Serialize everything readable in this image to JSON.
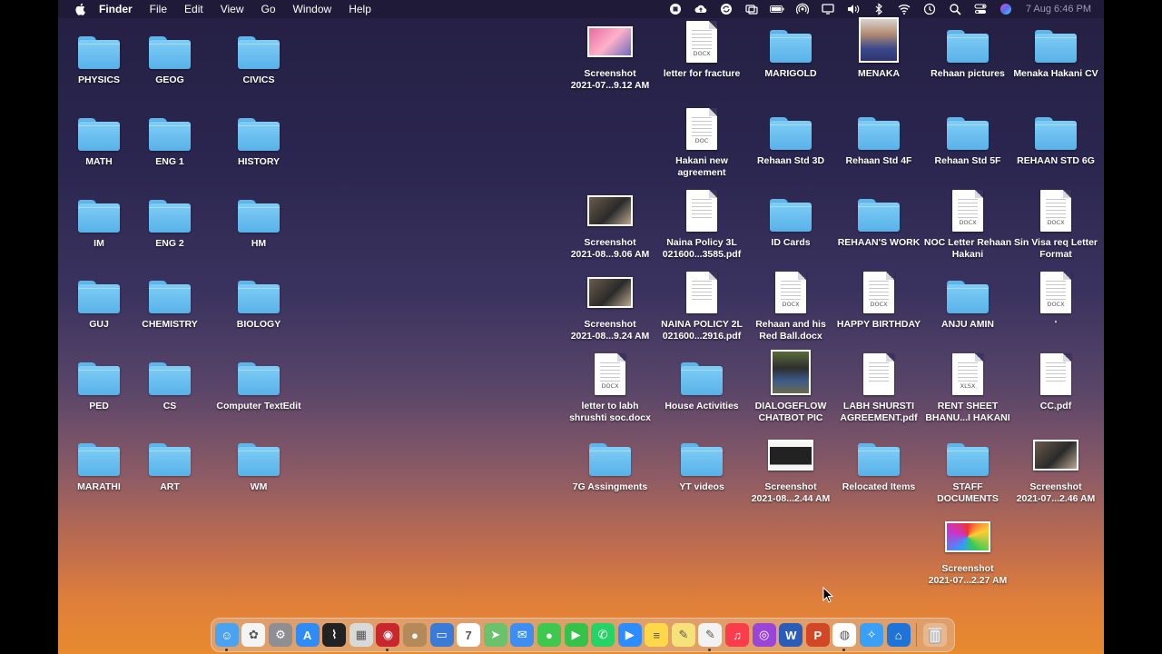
{
  "menubar": {
    "apple_icon": "apple-logo-icon",
    "app_name": "Finder",
    "menus": [
      "File",
      "Edit",
      "View",
      "Go",
      "Window",
      "Help"
    ],
    "status_icons": [
      "screen-record-icon",
      "creative-cloud-icon",
      "cloud-sync-icon",
      "display-mirror-icon",
      "battery-icon",
      "airdrop-icon",
      "screen-share-icon",
      "volume-icon",
      "bluetooth-icon",
      "wifi-icon",
      "time-machine-icon",
      "spotlight-icon",
      "control-center-icon",
      "siri-icon"
    ],
    "clock": "7 Aug  6:46 PM"
  },
  "desktop": {
    "left_grid": [
      {
        "label": "PHYSICS",
        "type": "folder"
      },
      {
        "label": "GEOG",
        "type": "folder"
      },
      {
        "label": "CIVICS",
        "type": "folder"
      },
      {
        "label": "MATH",
        "type": "folder"
      },
      {
        "label": "ENG 1",
        "type": "folder"
      },
      {
        "label": "HISTORY",
        "type": "folder"
      },
      {
        "label": "IM",
        "type": "folder"
      },
      {
        "label": "ENG 2",
        "type": "folder"
      },
      {
        "label": "HM",
        "type": "folder"
      },
      {
        "label": "GUJ",
        "type": "folder"
      },
      {
        "label": "CHEMISTRY",
        "type": "folder"
      },
      {
        "label": "BIOLOGY",
        "type": "folder"
      },
      {
        "label": "PED",
        "type": "folder"
      },
      {
        "label": "CS",
        "type": "folder"
      },
      {
        "label": "Computer TextEdit",
        "type": "folder"
      },
      {
        "label": "MARATHI",
        "type": "folder"
      },
      {
        "label": "ART",
        "type": "folder"
      },
      {
        "label": "WM",
        "type": "folder"
      }
    ],
    "right_grid": [
      {
        "label": "Screenshot\n2021-07...9.12 AM",
        "type": "shot",
        "variant": "pink"
      },
      {
        "label": "letter for fracture",
        "type": "doc",
        "ext": "DOCX"
      },
      {
        "label": "MARIGOLD",
        "type": "folder"
      },
      {
        "label": "MENAKA",
        "type": "photo",
        "variant": "menaka"
      },
      {
        "label": "Rehaan pictures",
        "type": "folder"
      },
      {
        "label": "Menaka Hakani CV",
        "type": "folder"
      },
      {
        "label": "Hakani new\nagreement",
        "type": "doc",
        "ext": "DOC"
      },
      {
        "label": "Rehaan Std 3D",
        "type": "folder"
      },
      {
        "label": "Rehaan Std 4F",
        "type": "folder"
      },
      {
        "label": "Rehaan Std 5F",
        "type": "folder"
      },
      {
        "label": "REHAAN STD 6G",
        "type": "folder"
      },
      {
        "label": "Screenshot\n2021-08...9.06 AM",
        "type": "shot",
        "variant": ""
      },
      {
        "label": "Naina Policy 3L\n021600...3585.pdf",
        "type": "doc",
        "ext": ""
      },
      {
        "label": "ID Cards",
        "type": "folder"
      },
      {
        "label": "REHAAN'S WORK",
        "type": "folder"
      },
      {
        "label": "NOC Letter Rehaan\nHakani",
        "type": "doc",
        "ext": "DOCX"
      },
      {
        "label": "Sin Visa req Letter\nFormat",
        "type": "doc",
        "ext": "DOCX"
      },
      {
        "label": "Screenshot\n2021-08...9.24 AM",
        "type": "shot",
        "variant": ""
      },
      {
        "label": "NAINA POLICY 2L\n021600...2916.pdf",
        "type": "doc",
        "ext": ""
      },
      {
        "label": "Rehaan and his\nRed Ball.docx",
        "type": "doc",
        "ext": "DOCX"
      },
      {
        "label": "HAPPY BIRTHDAY",
        "type": "doc",
        "ext": "DOCX"
      },
      {
        "label": "ANJU AMIN",
        "type": "folder"
      },
      {
        "label": "'",
        "type": "doc",
        "ext": "DOCX"
      },
      {
        "label": "letter to labh\nshrushti soc.docx",
        "type": "doc",
        "ext": "DOCX"
      },
      {
        "label": "House Activities",
        "type": "folder"
      },
      {
        "label": "DIALOGEFLOW\nCHATBOT PIC",
        "type": "photo",
        "variant": "dialog"
      },
      {
        "label": "LABH SHURSTI\nAGREEMENT.pdf",
        "type": "doc",
        "ext": ""
      },
      {
        "label": "RENT SHEET\nBHANU...I HAKANI",
        "type": "doc",
        "ext": "XLSX"
      },
      {
        "label": "CC.pdf",
        "type": "doc",
        "ext": ""
      },
      {
        "label": "7G Assingments",
        "type": "folder"
      },
      {
        "label": "YT videos",
        "type": "folder"
      },
      {
        "label": "Screenshot\n2021-08...2.44 AM",
        "type": "shot",
        "variant": "dark"
      },
      {
        "label": "Relocated Items",
        "type": "folder"
      },
      {
        "label": "STAFF\nDOCUMENTS",
        "type": "folder"
      },
      {
        "label": "Screenshot\n2021-07...2.46 AM",
        "type": "shot",
        "variant": ""
      },
      {
        "label": "Screenshot\n2021-07...2.27 AM",
        "type": "shot",
        "variant": "colorful"
      }
    ]
  },
  "dock": {
    "apps": [
      {
        "icon": "finder-icon",
        "color": "#4aa3f0",
        "running": true
      },
      {
        "icon": "photos-icon",
        "color": "#f4f4f4",
        "running": false
      },
      {
        "icon": "system-preferences-icon",
        "color": "#8e8e93",
        "running": false
      },
      {
        "icon": "app-store-icon",
        "color": "#2f8cf6",
        "running": false
      },
      {
        "icon": "activity-monitor-icon",
        "color": "#222222",
        "running": false
      },
      {
        "icon": "launchpad-icon",
        "color": "#d9d9d9",
        "running": false
      },
      {
        "icon": "photo-booth-icon",
        "color": "#c8282d",
        "running": true
      },
      {
        "icon": "contacts-icon",
        "color": "#b58a5a",
        "running": false
      },
      {
        "icon": "keynote-icon",
        "color": "#3b7bd8",
        "running": false
      },
      {
        "icon": "calendar-icon",
        "color": "#ffffff",
        "running": false
      },
      {
        "icon": "maps-icon",
        "color": "#6cc26a",
        "running": false
      },
      {
        "icon": "mail-icon",
        "color": "#3d8ef0",
        "running": false
      },
      {
        "icon": "messages-icon",
        "color": "#3ec84f",
        "running": false
      },
      {
        "icon": "facetime-icon",
        "color": "#35c24a",
        "running": false
      },
      {
        "icon": "whatsapp-icon",
        "color": "#25d366",
        "running": false
      },
      {
        "icon": "zoom-icon",
        "color": "#2d8cff",
        "running": false
      },
      {
        "icon": "notes-icon",
        "color": "#ffd84a",
        "running": false
      },
      {
        "icon": "stickies-icon",
        "color": "#f7e27a",
        "running": false
      },
      {
        "icon": "textedit-icon",
        "color": "#f2f2f2",
        "running": true
      },
      {
        "icon": "music-icon",
        "color": "#fa3c4c",
        "running": false
      },
      {
        "icon": "podcasts-icon",
        "color": "#9b45d8",
        "running": false
      },
      {
        "icon": "word-icon",
        "color": "#2b5cb8",
        "running": false
      },
      {
        "icon": "powerpoint-icon",
        "color": "#d24726",
        "running": false
      },
      {
        "icon": "chrome-icon",
        "color": "#ffffff",
        "running": true
      },
      {
        "icon": "safari-icon",
        "color": "#3aa0f5",
        "running": false
      },
      {
        "icon": "xcode-simulator-icon",
        "color": "#1e73d8",
        "running": false
      }
    ],
    "trash_icon": "trash-icon"
  }
}
